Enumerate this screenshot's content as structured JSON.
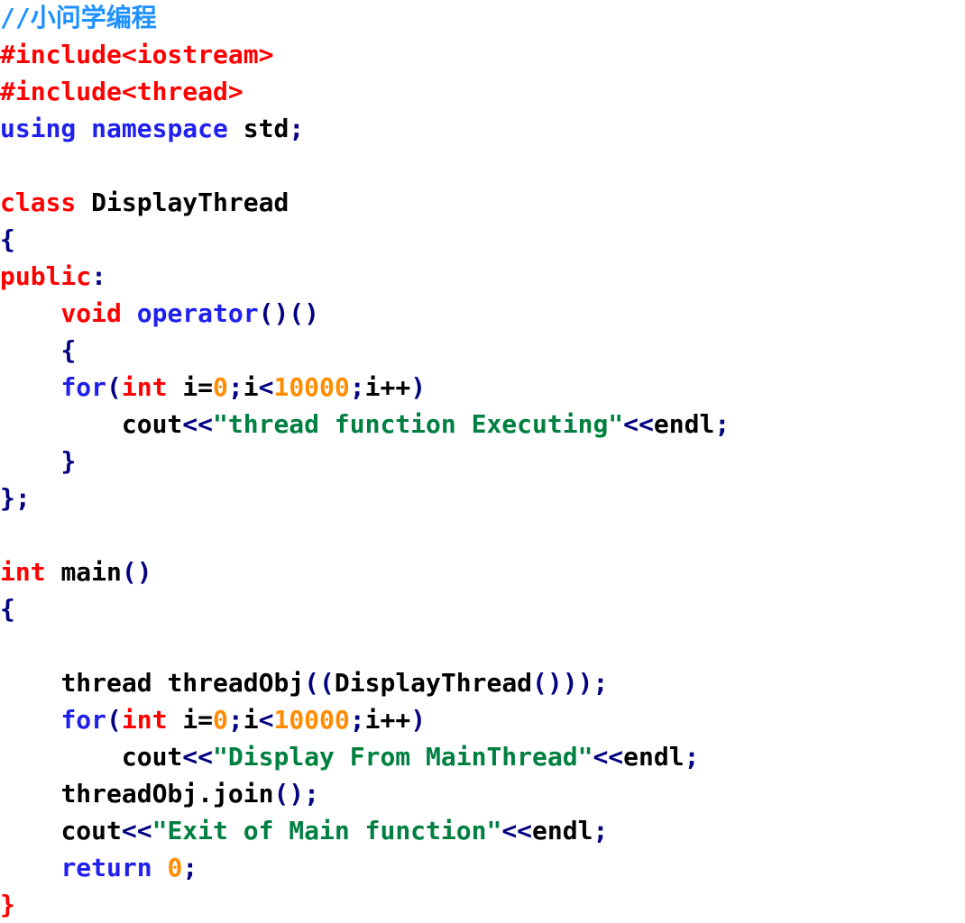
{
  "editor": {
    "language": "cpp",
    "background_color": "#FFFFFF",
    "font_size_px": 28,
    "line_height_px": 41
  },
  "colors": {
    "comment": "#1E90FF",
    "preprocessor": "#FF0000",
    "keyword": "#2020EE",
    "type_keyword": "#FF0000",
    "identifier": "#000000",
    "punctuation": "#000080",
    "number": "#FF8C00",
    "string": "#008040",
    "final_brace": "#FF0000"
  },
  "code": {
    "lines": [
      {
        "id": "line-1",
        "indent": "",
        "tokens": [
          {
            "t": "//小问学编程",
            "c": "comment"
          }
        ]
      },
      {
        "id": "line-2",
        "indent": "",
        "tokens": [
          {
            "t": "#include<iostream>",
            "c": "preproc"
          }
        ]
      },
      {
        "id": "line-3",
        "indent": "",
        "tokens": [
          {
            "t": "#include<thread>",
            "c": "preproc"
          }
        ]
      },
      {
        "id": "line-4",
        "indent": "",
        "tokens": [
          {
            "t": "using",
            "c": "keyword"
          },
          {
            "t": " ",
            "c": "plain"
          },
          {
            "t": "namespace",
            "c": "keyword"
          },
          {
            "t": " ",
            "c": "plain"
          },
          {
            "t": "std",
            "c": "plain"
          },
          {
            "t": ";",
            "c": "punct"
          }
        ]
      },
      {
        "id": "line-5",
        "indent": "",
        "tokens": []
      },
      {
        "id": "line-6",
        "indent": "",
        "tokens": [
          {
            "t": "class",
            "c": "type"
          },
          {
            "t": " ",
            "c": "plain"
          },
          {
            "t": "DisplayThread",
            "c": "plain"
          }
        ]
      },
      {
        "id": "line-7",
        "indent": "",
        "tokens": [
          {
            "t": "{",
            "c": "punct"
          }
        ]
      },
      {
        "id": "line-8",
        "indent": "",
        "tokens": [
          {
            "t": "public",
            "c": "type"
          },
          {
            "t": ":",
            "c": "punct"
          }
        ]
      },
      {
        "id": "line-9",
        "indent": "    ",
        "tokens": [
          {
            "t": "void",
            "c": "type"
          },
          {
            "t": " ",
            "c": "plain"
          },
          {
            "t": "operator",
            "c": "keyword"
          },
          {
            "t": "()()",
            "c": "punct"
          }
        ]
      },
      {
        "id": "line-10",
        "indent": "    ",
        "tokens": [
          {
            "t": "{",
            "c": "punct"
          }
        ]
      },
      {
        "id": "line-11",
        "indent": "    ",
        "tokens": [
          {
            "t": "for",
            "c": "keyword"
          },
          {
            "t": "(",
            "c": "punct"
          },
          {
            "t": "int",
            "c": "type"
          },
          {
            "t": " ",
            "c": "plain"
          },
          {
            "t": "i=",
            "c": "plain"
          },
          {
            "t": "0",
            "c": "number"
          },
          {
            "t": ";",
            "c": "punct"
          },
          {
            "t": "i",
            "c": "plain"
          },
          {
            "t": "<",
            "c": "punct"
          },
          {
            "t": "10000",
            "c": "number"
          },
          {
            "t": ";",
            "c": "punct"
          },
          {
            "t": "i++",
            "c": "plain"
          },
          {
            "t": ")",
            "c": "punct"
          }
        ]
      },
      {
        "id": "line-12",
        "indent": "        ",
        "tokens": [
          {
            "t": "cout",
            "c": "plain"
          },
          {
            "t": "<<",
            "c": "punct"
          },
          {
            "t": "\"thread function Executing\"",
            "c": "string"
          },
          {
            "t": "<<",
            "c": "punct"
          },
          {
            "t": "endl",
            "c": "plain"
          },
          {
            "t": ";",
            "c": "punct"
          }
        ]
      },
      {
        "id": "line-13",
        "indent": "    ",
        "tokens": [
          {
            "t": "}",
            "c": "punct"
          }
        ]
      },
      {
        "id": "line-14",
        "indent": "",
        "tokens": [
          {
            "t": "}",
            "c": "punct"
          },
          {
            "t": ";",
            "c": "punct"
          }
        ]
      },
      {
        "id": "line-15",
        "indent": "",
        "tokens": []
      },
      {
        "id": "line-16",
        "indent": "",
        "tokens": [
          {
            "t": "int",
            "c": "type"
          },
          {
            "t": " ",
            "c": "plain"
          },
          {
            "t": "main",
            "c": "plain"
          },
          {
            "t": "()",
            "c": "punct"
          }
        ]
      },
      {
        "id": "line-17",
        "indent": "",
        "tokens": [
          {
            "t": "{",
            "c": "punct"
          }
        ]
      },
      {
        "id": "line-18",
        "indent": "",
        "tokens": []
      },
      {
        "id": "line-19",
        "indent": "    ",
        "tokens": [
          {
            "t": "thread",
            "c": "plain"
          },
          {
            "t": " ",
            "c": "plain"
          },
          {
            "t": "threadObj",
            "c": "plain"
          },
          {
            "t": "((",
            "c": "punct"
          },
          {
            "t": "DisplayThread",
            "c": "plain"
          },
          {
            "t": "()));",
            "c": "punct"
          }
        ]
      },
      {
        "id": "line-20",
        "indent": "    ",
        "tokens": [
          {
            "t": "for",
            "c": "keyword"
          },
          {
            "t": "(",
            "c": "punct"
          },
          {
            "t": "int",
            "c": "type"
          },
          {
            "t": " ",
            "c": "plain"
          },
          {
            "t": "i=",
            "c": "plain"
          },
          {
            "t": "0",
            "c": "number"
          },
          {
            "t": ";",
            "c": "punct"
          },
          {
            "t": "i",
            "c": "plain"
          },
          {
            "t": "<",
            "c": "punct"
          },
          {
            "t": "10000",
            "c": "number"
          },
          {
            "t": ";",
            "c": "punct"
          },
          {
            "t": "i++",
            "c": "plain"
          },
          {
            "t": ")",
            "c": "punct"
          }
        ]
      },
      {
        "id": "line-21",
        "indent": "        ",
        "tokens": [
          {
            "t": "cout",
            "c": "plain"
          },
          {
            "t": "<<",
            "c": "punct"
          },
          {
            "t": "\"Display From MainThread\"",
            "c": "string"
          },
          {
            "t": "<<",
            "c": "punct"
          },
          {
            "t": "endl",
            "c": "plain"
          },
          {
            "t": ";",
            "c": "punct"
          }
        ]
      },
      {
        "id": "line-22",
        "indent": "    ",
        "tokens": [
          {
            "t": "threadObj",
            "c": "plain"
          },
          {
            "t": ".",
            "c": "plain"
          },
          {
            "t": "join",
            "c": "plain"
          },
          {
            "t": "();",
            "c": "punct"
          }
        ]
      },
      {
        "id": "line-23",
        "indent": "    ",
        "tokens": [
          {
            "t": "cout",
            "c": "plain"
          },
          {
            "t": "<<",
            "c": "punct"
          },
          {
            "t": "\"Exit of Main function\"",
            "c": "string"
          },
          {
            "t": "<<",
            "c": "punct"
          },
          {
            "t": "endl",
            "c": "plain"
          },
          {
            "t": ";",
            "c": "punct"
          }
        ]
      },
      {
        "id": "line-24",
        "indent": "    ",
        "tokens": [
          {
            "t": "return",
            "c": "keyword"
          },
          {
            "t": " ",
            "c": "plain"
          },
          {
            "t": "0",
            "c": "number"
          },
          {
            "t": ";",
            "c": "punct"
          }
        ]
      },
      {
        "id": "line-25",
        "indent": "",
        "tokens": [
          {
            "t": "}",
            "c": "brace-end"
          }
        ]
      }
    ]
  }
}
